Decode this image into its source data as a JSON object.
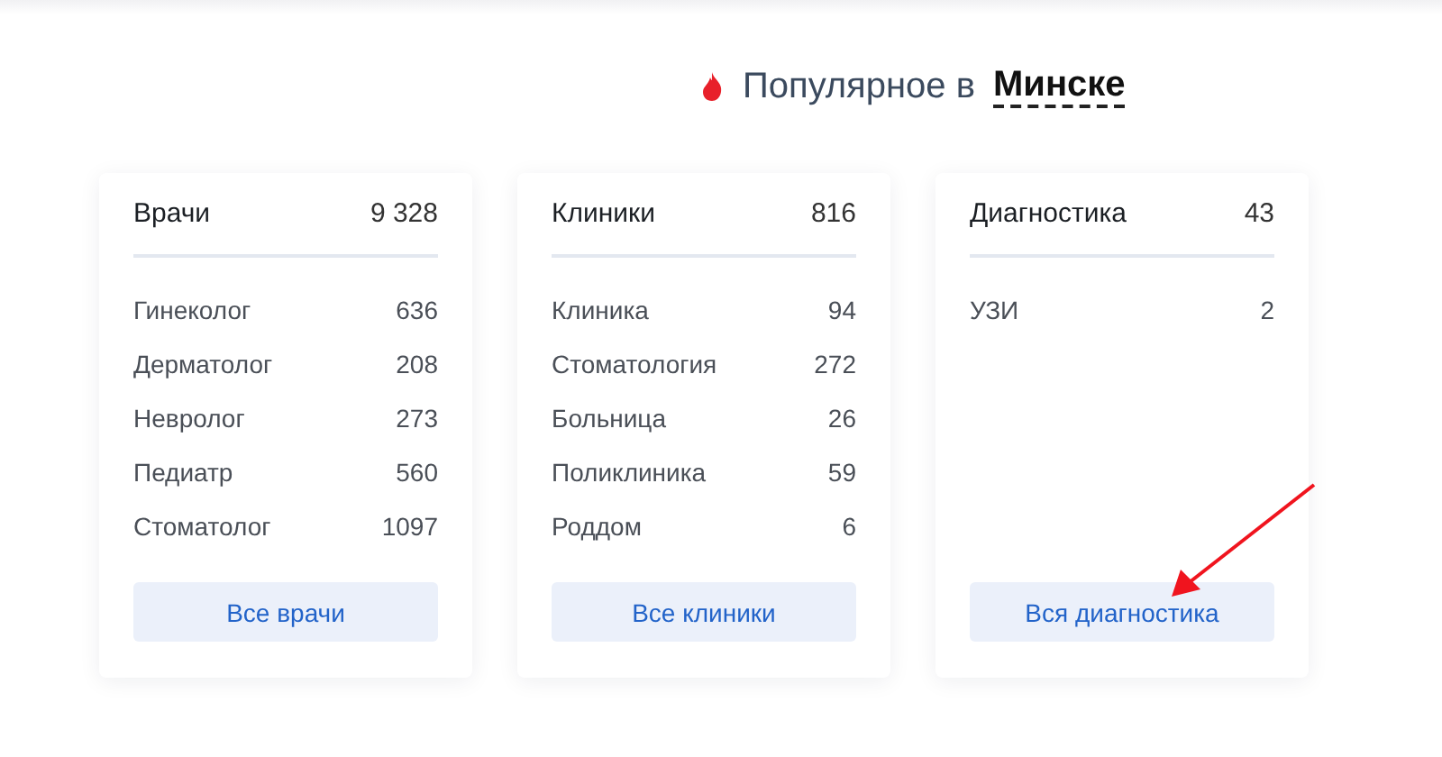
{
  "header": {
    "title": "Популярное в",
    "city": "Минске"
  },
  "cards": [
    {
      "title": "Врачи",
      "count": "9 328",
      "items": [
        {
          "name": "Гинеколог",
          "count": "636"
        },
        {
          "name": "Дерматолог",
          "count": "208"
        },
        {
          "name": "Невролог",
          "count": "273"
        },
        {
          "name": "Педиатр",
          "count": "560"
        },
        {
          "name": "Стоматолог",
          "count": "1097"
        }
      ],
      "button": "Все врачи"
    },
    {
      "title": "Клиники",
      "count": "816",
      "items": [
        {
          "name": "Клиника",
          "count": "94"
        },
        {
          "name": "Стоматология",
          "count": "272"
        },
        {
          "name": "Больница",
          "count": "26"
        },
        {
          "name": "Поликлиника",
          "count": "59"
        },
        {
          "name": "Роддом",
          "count": "6"
        }
      ],
      "button": "Все клиники"
    },
    {
      "title": "Диагностика",
      "count": "43",
      "items": [
        {
          "name": "УЗИ",
          "count": "2"
        }
      ],
      "button": "Вся диагностика"
    }
  ]
}
